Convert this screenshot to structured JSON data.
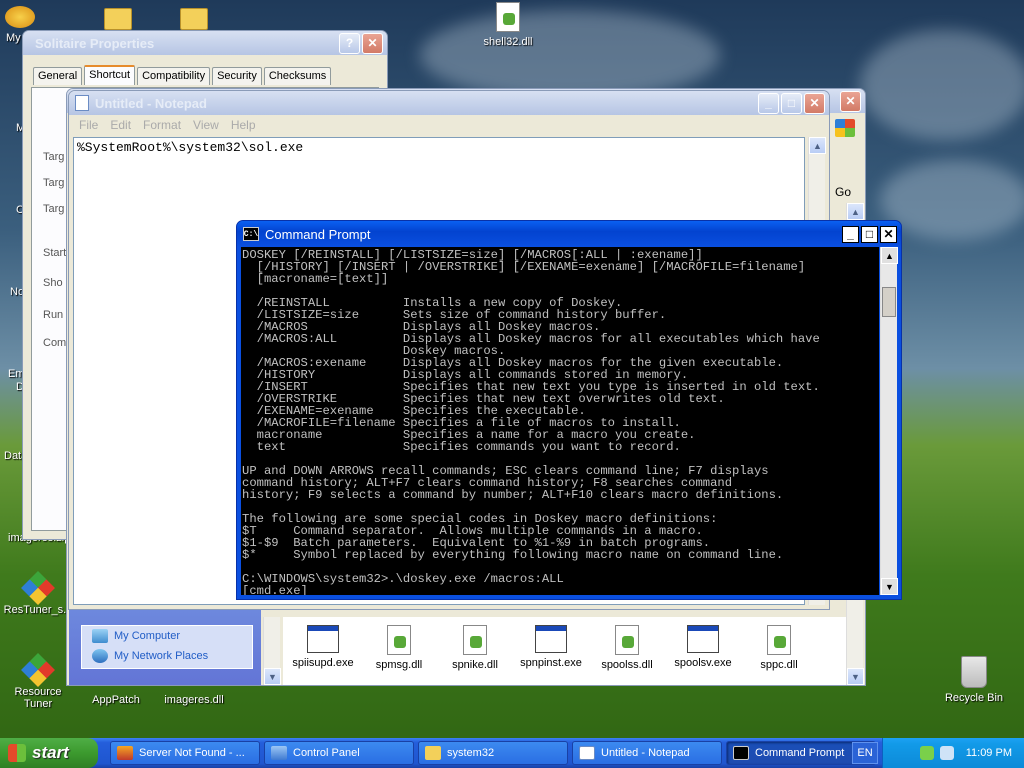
{
  "desktop": {
    "icons": [
      {
        "label": "My"
      },
      {
        "label": "shell32.dll"
      },
      {
        "label": "imageres.zip"
      },
      {
        "label": "ResTuner_s..."
      },
      {
        "label": "Resource Tuner"
      },
      {
        "label": "AppPatch"
      },
      {
        "label": "imageres.dll"
      },
      {
        "label": "Recycle Bin"
      }
    ],
    "edge_labels": [
      "M",
      "C",
      "No",
      "Em",
      "D",
      "Data"
    ]
  },
  "solitaire_props": {
    "title": "Solitaire Properties",
    "tabs": [
      "General",
      "Shortcut",
      "Compatibility",
      "Security",
      "Checksums"
    ],
    "selected_tab": "Shortcut",
    "side_labels": [
      "Targ",
      "Targ",
      "Targ",
      "Start",
      "Sho",
      "Run",
      "Com"
    ]
  },
  "notepad": {
    "title": "Untitled - Notepad",
    "menu": [
      "File",
      "Edit",
      "Format",
      "View",
      "Help"
    ],
    "content": "%SystemRoot%\\system32\\sol.exe"
  },
  "explorer": {
    "go_label": "Go",
    "links": [
      {
        "label": "My Computer",
        "icon": "computer-icon"
      },
      {
        "label": "My Network Places",
        "icon": "network-icon"
      }
    ],
    "files": [
      {
        "name": "spiisupd.exe",
        "type": "exe"
      },
      {
        "name": "spmsg.dll",
        "type": "dll"
      },
      {
        "name": "spnike.dll",
        "type": "dll"
      },
      {
        "name": "spnpinst.exe",
        "type": "exe"
      },
      {
        "name": "spoolss.dll",
        "type": "dll"
      },
      {
        "name": "spoolsv.exe",
        "type": "exe"
      },
      {
        "name": "sppc.dll",
        "type": "dll"
      }
    ]
  },
  "cmd": {
    "title": "Command Prompt",
    "icon_text": "C:\\",
    "lines": [
      "DOSKEY [/REINSTALL] [/LISTSIZE=size] [/MACROS[:ALL | :exename]]",
      "  [/HISTORY] [/INSERT | /OVERSTRIKE] [/EXENAME=exename] [/MACROFILE=filename]",
      "  [macroname=[text]]",
      "",
      "  /REINSTALL          Installs a new copy of Doskey.",
      "  /LISTSIZE=size      Sets size of command history buffer.",
      "  /MACROS             Displays all Doskey macros.",
      "  /MACROS:ALL         Displays all Doskey macros for all executables which have",
      "                      Doskey macros.",
      "  /MACROS:exename     Displays all Doskey macros for the given executable.",
      "  /HISTORY            Displays all commands stored in memory.",
      "  /INSERT             Specifies that new text you type is inserted in old text.",
      "  /OVERSTRIKE         Specifies that new text overwrites old text.",
      "  /EXENAME=exename    Specifies the executable.",
      "  /MACROFILE=filename Specifies a file of macros to install.",
      "  macroname           Specifies a name for a macro you create.",
      "  text                Specifies commands you want to record.",
      "",
      "UP and DOWN ARROWS recall commands; ESC clears command line; F7 displays",
      "command history; ALT+F7 clears command history; F8 searches command",
      "history; F9 selects a command by number; ALT+F10 clears macro definitions.",
      "",
      "The following are some special codes in Doskey macro definitions:",
      "$T     Command separator.  Allows multiple commands in a macro.",
      "$1-$9  Batch parameters.  Equivalent to %1-%9 in batch programs.",
      "$*     Symbol replaced by everything following macro name on command line.",
      "",
      "C:\\WINDOWS\\system32>.\\doskey.exe /macros:ALL",
      "[cmd.exe]"
    ]
  },
  "taskbar": {
    "start_label": "start",
    "buttons": [
      {
        "label": "Server Not Found - ...",
        "icon": "browser-icon",
        "active": false
      },
      {
        "label": "Control Panel",
        "icon": "control-panel-icon",
        "active": false
      },
      {
        "label": "system32",
        "icon": "folder-icon",
        "active": false
      },
      {
        "label": "Untitled - Notepad",
        "icon": "notepad-icon",
        "active": false
      },
      {
        "label": "Command Prompt",
        "icon": "cmd-icon",
        "active": true
      }
    ],
    "language": "EN",
    "clock": "11:09 PM"
  }
}
